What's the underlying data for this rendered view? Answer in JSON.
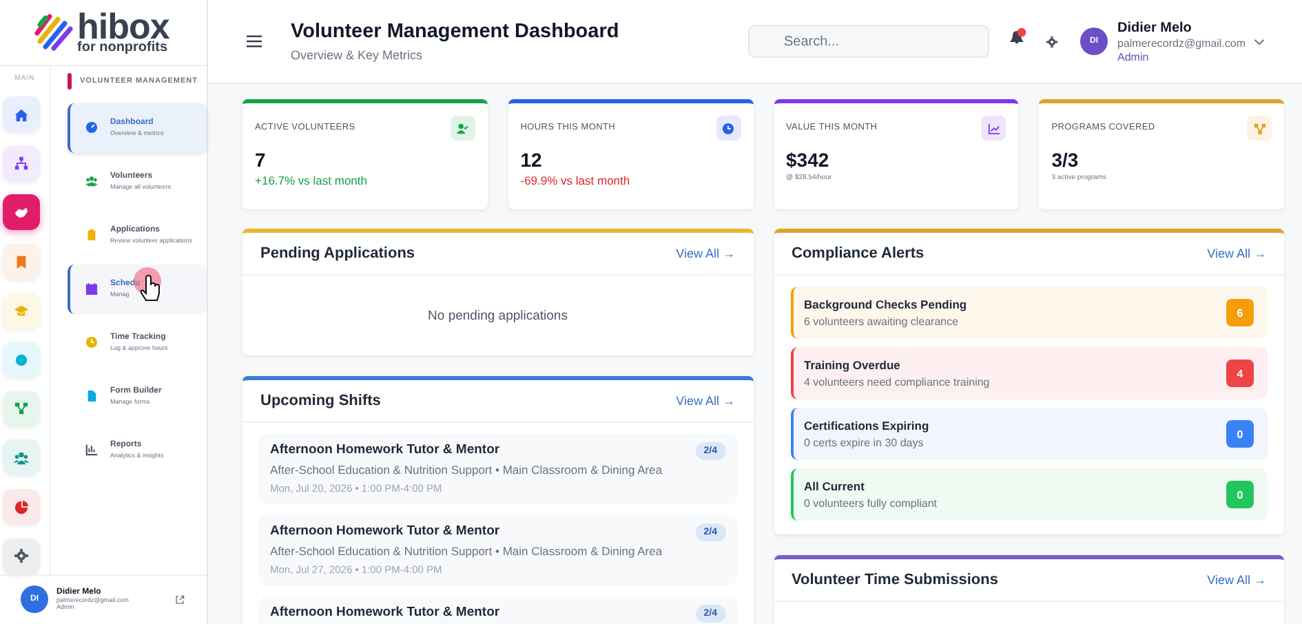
{
  "logo": {
    "name": "hibox",
    "tagline": "for nonprofits"
  },
  "rail": {
    "label": "MAIN",
    "items": [
      {
        "color": "#2563eb",
        "selected": false
      },
      {
        "color": "#7c3aed",
        "selected": false
      },
      {
        "color": "#e11d6a",
        "selected": true
      },
      {
        "color": "#ea7a1c",
        "selected": false
      },
      {
        "color": "#eab308",
        "selected": false
      },
      {
        "color": "#06b6d4",
        "selected": false
      },
      {
        "color": "#16a34a",
        "selected": false
      },
      {
        "color": "#0d9488",
        "selected": false
      },
      {
        "color": "#dc2626",
        "selected": false
      },
      {
        "color": "#4b5563",
        "selected": false
      }
    ]
  },
  "submenu": {
    "heading": "VOLUNTEER MANAGEMENT",
    "items": [
      {
        "color": "#2563eb",
        "label": "Dashboard",
        "sub": "Overview & metrics",
        "selected": true,
        "hovered": false
      },
      {
        "color": "#16a34a",
        "label": "Volunteers",
        "sub": "Manage all volunteers",
        "selected": false,
        "hovered": false
      },
      {
        "color": "#eab308",
        "label": "Applications",
        "sub": "Review volunteer applications",
        "selected": false,
        "hovered": false
      },
      {
        "color": "#7c3aed",
        "label": "Schedu",
        "sub": "Manag",
        "selected": false,
        "hovered": true
      },
      {
        "color": "#eab308",
        "label": "Time Tracking",
        "sub": "Log & approve hours",
        "selected": false,
        "hovered": false
      },
      {
        "color": "#0ea5e9",
        "label": "Form Builder",
        "sub": "Manage forms",
        "selected": false,
        "hovered": false
      },
      {
        "color": "#4b5563",
        "label": "Reports",
        "sub": "Analytics & insights",
        "selected": false,
        "hovered": false
      }
    ]
  },
  "sidebar_user": {
    "initials": "DI",
    "name": "Didier Melo",
    "email": "palmerecordz@gmail.com",
    "role": "Admin"
  },
  "header": {
    "title": "Volunteer Management Dashboard",
    "subtitle": "Overview & Key Metrics",
    "search": {
      "placeholder": "Search..."
    },
    "user": {
      "initials": "DI",
      "name": "Didier Melo",
      "email": "palmerecordz@gmail.com",
      "role": "Admin"
    }
  },
  "stats": [
    {
      "label": "ACTIVE VOLUNTEERS",
      "value": "7",
      "note": "+16.7% vs last month",
      "kind": "positive",
      "color": "#16a34a"
    },
    {
      "label": "HOURS THIS MONTH",
      "value": "12",
      "note": "-69.9% vs last month",
      "kind": "negative",
      "color": "#2563eb"
    },
    {
      "label": "VALUE THIS MONTH",
      "value": "$342",
      "note": "@ $28.54/hour",
      "kind": "plain",
      "color": "#7c3aed"
    },
    {
      "label": "PROGRAMS COVERED",
      "value": "3/3",
      "note": "3 active programs",
      "kind": "plain",
      "color": "#e0a22a"
    }
  ],
  "pending": {
    "title": "Pending Applications",
    "link": "View All →",
    "empty": "No pending applications"
  },
  "shifts": {
    "title": "Upcoming Shifts",
    "link": "View All →",
    "items": [
      {
        "title": "Afternoon Homework Tutor & Mentor",
        "detail": "After-School Education & Nutrition Support • Main Classroom & Dining Area",
        "when": "Mon, Jul 20, 2026 • 1:00 PM-4:00 PM",
        "filled": "2/4"
      },
      {
        "title": "Afternoon Homework Tutor & Mentor",
        "detail": "After-School Education & Nutrition Support • Main Classroom & Dining Area",
        "when": "Mon, Jul 27, 2026 • 1:00 PM-4:00 PM",
        "filled": "2/4"
      },
      {
        "title": "Afternoon Homework Tutor & Mentor",
        "filled": "2/4"
      }
    ]
  },
  "compliance": {
    "title": "Compliance Alerts",
    "link": "View All →",
    "items": [
      {
        "title": "Background Checks Pending",
        "detail": "6 volunteers awaiting clearance",
        "count": "6",
        "color": "#f59e0b"
      },
      {
        "title": "Training Overdue",
        "detail": "4 volunteers need compliance training",
        "count": "4",
        "color": "#ef4444"
      },
      {
        "title": "Certifications Expiring",
        "detail": "0 certs expire in 30 days",
        "count": "0",
        "color": "#3b82f6"
      },
      {
        "title": "All Current",
        "detail": "0 volunteers fully compliant",
        "count": "0",
        "color": "#22c55e"
      }
    ]
  },
  "time_submissions": {
    "title": "Volunteer Time Submissions",
    "link": "View All →"
  }
}
